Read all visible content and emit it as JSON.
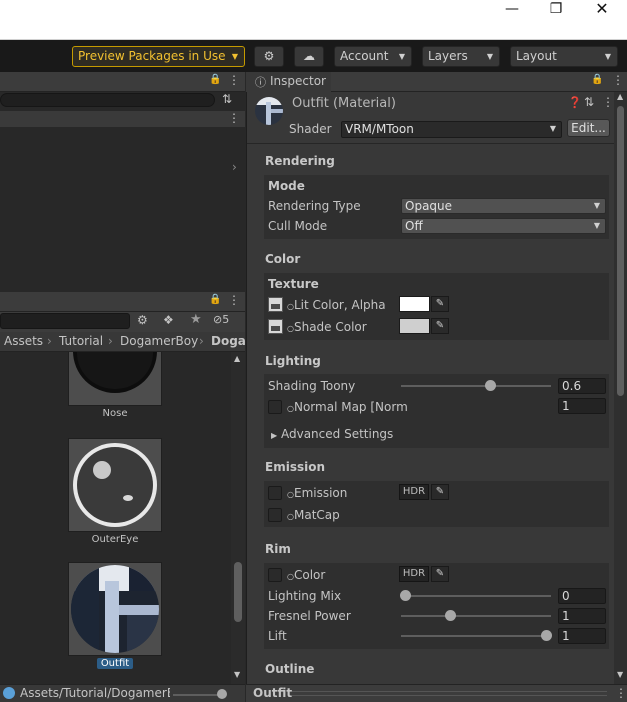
{
  "window": {
    "minimize_icon": "minimize-icon",
    "restore_icon": "restore-icon",
    "close_icon": "close-icon"
  },
  "toolbar": {
    "preview_packages": "Preview Packages in Use",
    "account": "Account",
    "layers": "Layers",
    "layout": "Layout"
  },
  "project": {
    "breadcrumb": [
      "Assets",
      "Tutorial",
      "DogamerBoy",
      "Doga"
    ],
    "search_count": "5",
    "items": [
      {
        "name": "Nose"
      },
      {
        "name": "OuterEye"
      },
      {
        "name": "Outfit"
      }
    ],
    "status_path": "Assets/Tutorial/DogamerBc"
  },
  "inspector": {
    "tab_label": "Inspector",
    "material_title": "Outfit (Material)",
    "shader_label": "Shader",
    "shader_value": "VRM/MToon",
    "edit_button": "Edit...",
    "rendering": {
      "title": "Rendering",
      "mode_title": "Mode",
      "rendering_type_label": "Rendering Type",
      "rendering_type_value": "Opaque",
      "cull_mode_label": "Cull Mode",
      "cull_mode_value": "Off"
    },
    "color": {
      "title": "Color",
      "texture_title": "Texture",
      "lit_color_label": "Lit Color, Alpha",
      "shade_color_label": "Shade Color",
      "lit_color_hex": "#ffffff",
      "shade_color_hex": "#cfcfcf"
    },
    "lighting": {
      "title": "Lighting",
      "shading_toony_label": "Shading Toony",
      "shading_toony_value": "0.6",
      "normal_map_label": "Normal Map [Norm",
      "normal_map_value": "1",
      "advanced_settings": "Advanced Settings"
    },
    "emission": {
      "title": "Emission",
      "emission_label": "Emission",
      "hdr_label": "HDR",
      "matcap_label": "MatCap"
    },
    "rim": {
      "title": "Rim",
      "color_label": "Color",
      "hdr_label": "HDR",
      "lighting_mix_label": "Lighting Mix",
      "lighting_mix_value": "0",
      "fresnel_power_label": "Fresnel Power",
      "fresnel_power_value": "1",
      "lift_label": "Lift",
      "lift_value": "1"
    },
    "outline": {
      "title": "Outline"
    },
    "footer_label": "Outfit"
  }
}
